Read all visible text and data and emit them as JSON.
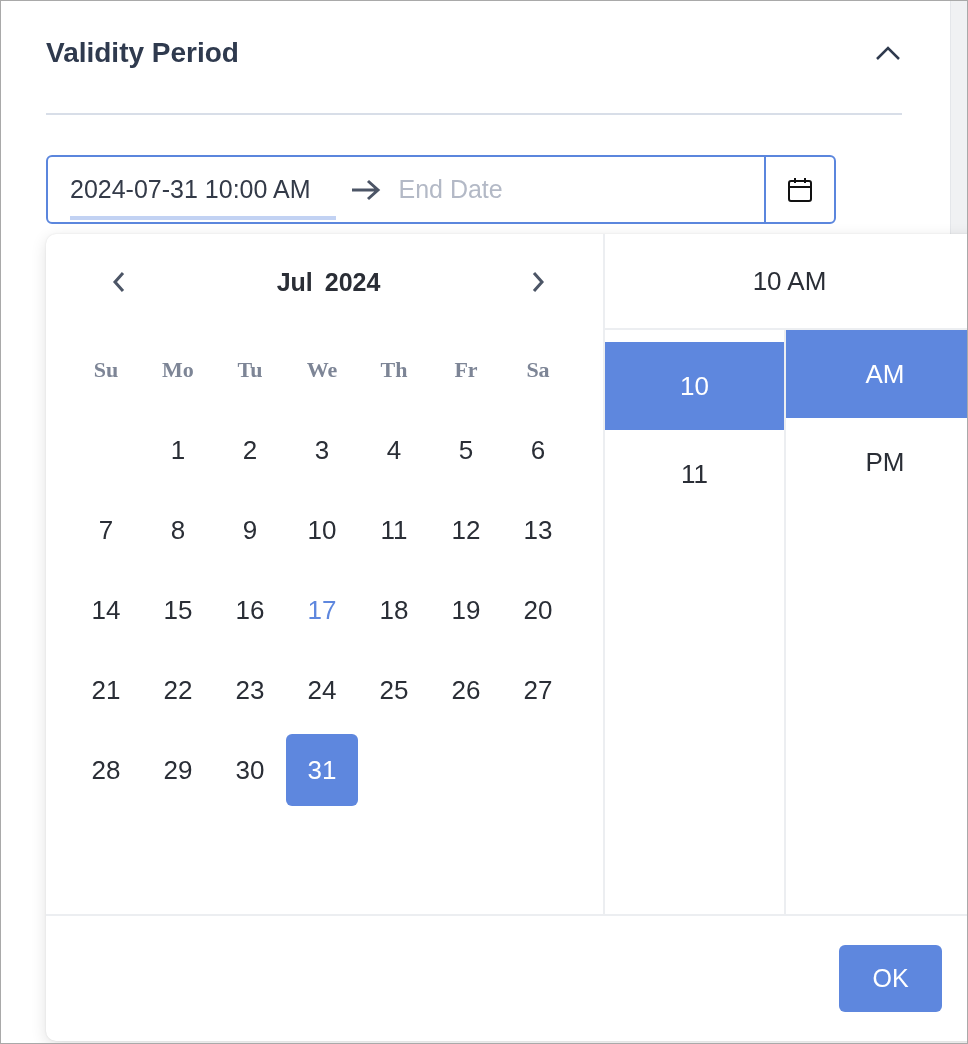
{
  "section": {
    "title": "Validity Period",
    "expanded": true
  },
  "range_input": {
    "start_value": "2024-07-31 10:00 AM",
    "start_active": true,
    "end_placeholder": "End Date"
  },
  "picker": {
    "month": "Jul",
    "year": "2024",
    "weekdays": [
      "Su",
      "Mo",
      "Tu",
      "We",
      "Th",
      "Fr",
      "Sa"
    ],
    "weeks": [
      [
        {
          "day": "1",
          "selected": false,
          "today": false
        },
        {
          "day": "2",
          "selected": false,
          "today": false
        },
        {
          "day": "3",
          "selected": false,
          "today": false
        },
        {
          "day": "4",
          "selected": false,
          "today": false
        },
        {
          "day": "5",
          "selected": false,
          "today": false
        },
        {
          "day": "6",
          "selected": false,
          "today": false
        }
      ],
      [
        {
          "day": "7",
          "selected": false,
          "today": false
        },
        {
          "day": "8",
          "selected": false,
          "today": false
        },
        {
          "day": "9",
          "selected": false,
          "today": false
        },
        {
          "day": "10",
          "selected": false,
          "today": false
        },
        {
          "day": "11",
          "selected": false,
          "today": false
        },
        {
          "day": "12",
          "selected": false,
          "today": false
        },
        {
          "day": "13",
          "selected": false,
          "today": false
        }
      ],
      [
        {
          "day": "14",
          "selected": false,
          "today": false
        },
        {
          "day": "15",
          "selected": false,
          "today": false
        },
        {
          "day": "16",
          "selected": false,
          "today": false
        },
        {
          "day": "17",
          "selected": false,
          "today": true
        },
        {
          "day": "18",
          "selected": false,
          "today": false
        },
        {
          "day": "19",
          "selected": false,
          "today": false
        },
        {
          "day": "20",
          "selected": false,
          "today": false
        }
      ],
      [
        {
          "day": "21",
          "selected": false,
          "today": false
        },
        {
          "day": "22",
          "selected": false,
          "today": false
        },
        {
          "day": "23",
          "selected": false,
          "today": false
        },
        {
          "day": "24",
          "selected": false,
          "today": false
        },
        {
          "day": "25",
          "selected": false,
          "today": false
        },
        {
          "day": "26",
          "selected": false,
          "today": false
        },
        {
          "day": "27",
          "selected": false,
          "today": false
        }
      ],
      [
        {
          "day": "28",
          "selected": false,
          "today": false
        },
        {
          "day": "29",
          "selected": false,
          "today": false
        },
        {
          "day": "30",
          "selected": false,
          "today": false
        },
        {
          "day": "31",
          "selected": true,
          "today": false
        }
      ]
    ],
    "time_display": "10 AM",
    "hours": [
      {
        "label": "10",
        "selected": true
      },
      {
        "label": "11",
        "selected": false
      }
    ],
    "periods": [
      {
        "label": "AM",
        "selected": true
      },
      {
        "label": "PM",
        "selected": false
      }
    ],
    "ok_label": "OK"
  }
}
